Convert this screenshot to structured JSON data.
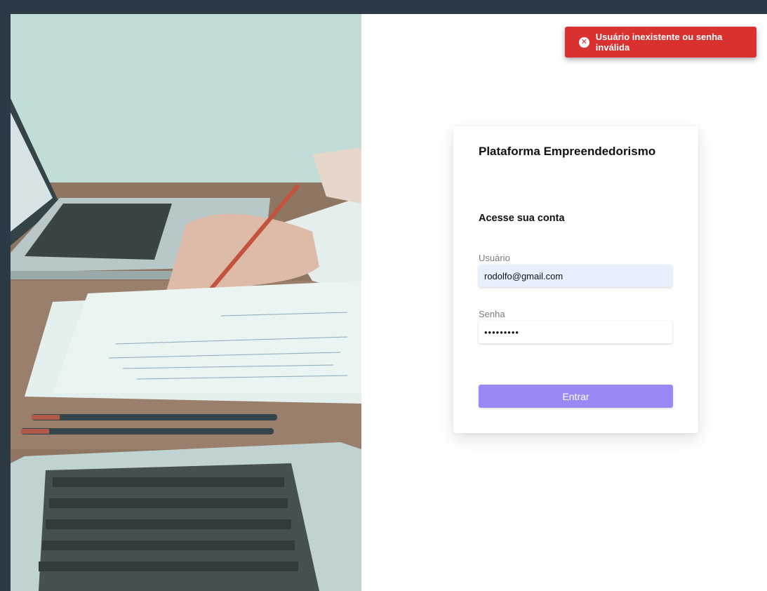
{
  "hero": {
    "image_alt": "desk-with-laptops-and-hand-writing"
  },
  "toast": {
    "icon": "error-circle-x-icon",
    "icon_glyph": "✕",
    "message": "Usuário inexistente ou senha inválida",
    "color": "#d9312f"
  },
  "login": {
    "title": "Plataforma Empreendedorismo",
    "subtitle": "Acesse sua conta",
    "username_label": "Usuário",
    "username_value": "rodolfo@gmail.com",
    "password_label": "Senha",
    "password_value": "123456789",
    "submit_label": "Entrar",
    "accent_color": "#9b87f5"
  }
}
